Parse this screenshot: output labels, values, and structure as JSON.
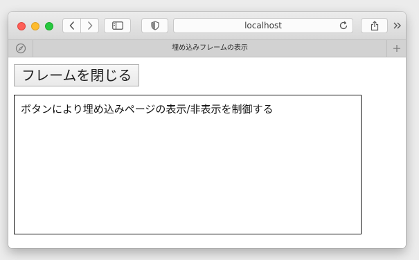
{
  "browser": {
    "address_text": "localhost",
    "tab_title": "埋め込みフレームの表示",
    "new_tab_symbol": "+",
    "overflow_symbol": "»"
  },
  "toolbar_icons": {
    "back": "chevron-left-icon",
    "forward": "chevron-right-icon",
    "sidebar": "sidebar-icon",
    "privacy": "shield-icon",
    "reload": "reload-icon",
    "share": "share-icon",
    "compass": "compass-icon"
  },
  "page": {
    "close_button_label": "フレームを閉じる",
    "iframe_text": "ボタンにより埋め込みページの表示/非表示を制御する"
  },
  "colors": {
    "close": "#fe5f57",
    "minimize": "#febc2e",
    "zoom": "#28c840"
  }
}
